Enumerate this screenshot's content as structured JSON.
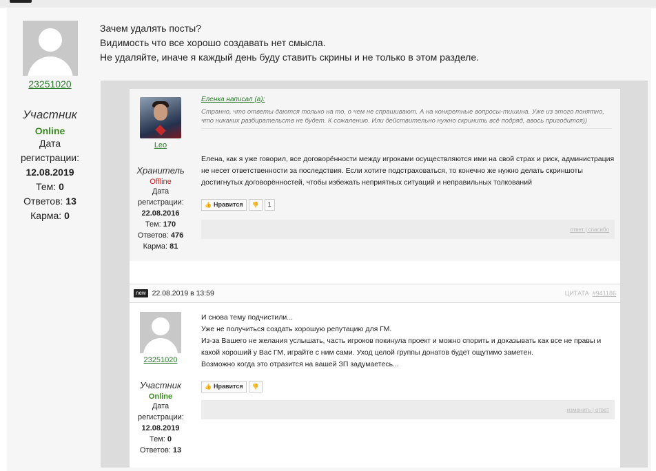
{
  "author": {
    "username": "23251020",
    "role": "Участник",
    "status": "Online",
    "reg_label": "Дата регистрации:",
    "reg_date": "12.08.2019",
    "topics_label": "Тем:",
    "topics": "0",
    "answers_label": "Ответов:",
    "answers": "13",
    "karma_label": "Карма:",
    "karma": "0"
  },
  "message": {
    "lines": [
      "Зачем удалять посты?",
      "Видимость что все хорошо создавать нет смысла.",
      "Не удаляйте, иначе я каждый день буду ставить скрины и не только в этом разделе."
    ]
  },
  "screenshot": {
    "reply1": {
      "author": {
        "username": "Leo",
        "role": "Хранитель",
        "status": "Offline",
        "reg_label": "Дата регистрации:",
        "reg_date": "22.08.2016",
        "topics_label": "Тем:",
        "topics": "170",
        "answers_label": "Ответов:",
        "answers": "476",
        "karma_label": "Карма:",
        "karma": "81"
      },
      "quote_head": "Еленка написал (а):",
      "quote_text": "Странно, что ответы даются только на то, о чем не спрашивают. А на конкретные вопросы-тишина. Уже из этого понятно, что никаких разбирательств не будет. К сожалению. Или действительно нужно скринить всё подряд, авось пригодится))",
      "text": "Елена, как я уже говорил, все договорённости между игроками осуществляются ими на свой страх и риск, администрация не несет ответственности за последствия. Если хотите подстраховаться, то конечно же нужно делать скриншоты достигнутых договорённостей, чтобы избежать неприятных ситуаций и неправильных толкований",
      "like_label": "Нравится",
      "dislike_count": "1",
      "action_reply": "ответ",
      "action_thanks": "спасибо"
    },
    "post2": {
      "new_tag": "new",
      "date": "22.08.2019 в 13:59",
      "quote_label": "ЦИТАТА",
      "post_number": "#941186",
      "author": {
        "username": "23251020",
        "role": "Участник",
        "status": "Online",
        "reg_label": "Дата регистрации:",
        "reg_date": "12.08.2019",
        "topics_label": "Тем:",
        "topics": "0",
        "answers_label": "Ответов:",
        "answers": "13"
      },
      "lines": [
        "И снова тему подчистили...",
        "Уже не получиться создать хорошую репутацию для ГМ.",
        "Из-за Вашего не желания услышать, часть игроков покинула проект и можно спорить и доказывать как все не правы и какой хороший у Вас ГМ, играйте с ним сами. Уход целой группы донатов будет ощутимо заметен.",
        "Возможно когда это отразится на вашей ЗП задумаетесь..."
      ],
      "like_label": "Нравится",
      "action_edit": "изменить",
      "action_reply": "ответ"
    }
  }
}
